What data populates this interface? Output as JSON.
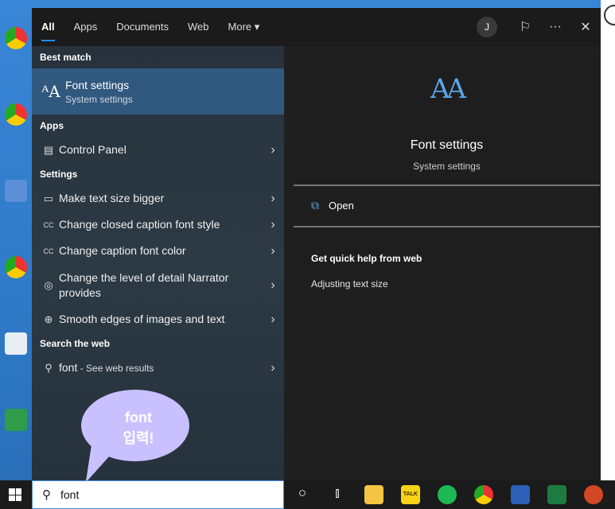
{
  "tabs": [
    {
      "label": "All"
    },
    {
      "label": "Apps"
    },
    {
      "label": "Documents"
    },
    {
      "label": "Web"
    },
    {
      "label": "More ▾"
    }
  ],
  "user_initial": "J",
  "sections": {
    "best_match": "Best match",
    "apps": "Apps",
    "settings": "Settings",
    "search_web": "Search the web"
  },
  "best_match": {
    "title": "Font settings",
    "subtitle": "System settings"
  },
  "apps": [
    {
      "label": "Control Panel"
    }
  ],
  "settings": [
    {
      "label": "Make text size bigger"
    },
    {
      "label": "Change closed caption font style"
    },
    {
      "label": "Change caption font color"
    },
    {
      "label": "Change the level of detail Narrator provides"
    },
    {
      "label": "Smooth edges of images and text"
    }
  ],
  "web": {
    "query": "font",
    "suffix": " - See web results"
  },
  "preview": {
    "icon_text": "AA",
    "title": "Font settings",
    "subtitle": "System settings",
    "open_label": "Open",
    "quick_help": "Get quick help from web",
    "help_link": "Adjusting text size"
  },
  "annotation": {
    "line1": "font",
    "line2": "입력!"
  },
  "search": {
    "value": "font"
  },
  "taskbar_apps": [
    "cortana-circle-icon",
    "task-view-icon",
    "file-explorer-icon",
    "kakaotalk-icon",
    "spotify-icon",
    "chrome-icon",
    "word-icon",
    "excel-icon",
    "powerpoint-icon"
  ],
  "taskbar": {
    "kakaotalk_label": "TALK"
  }
}
